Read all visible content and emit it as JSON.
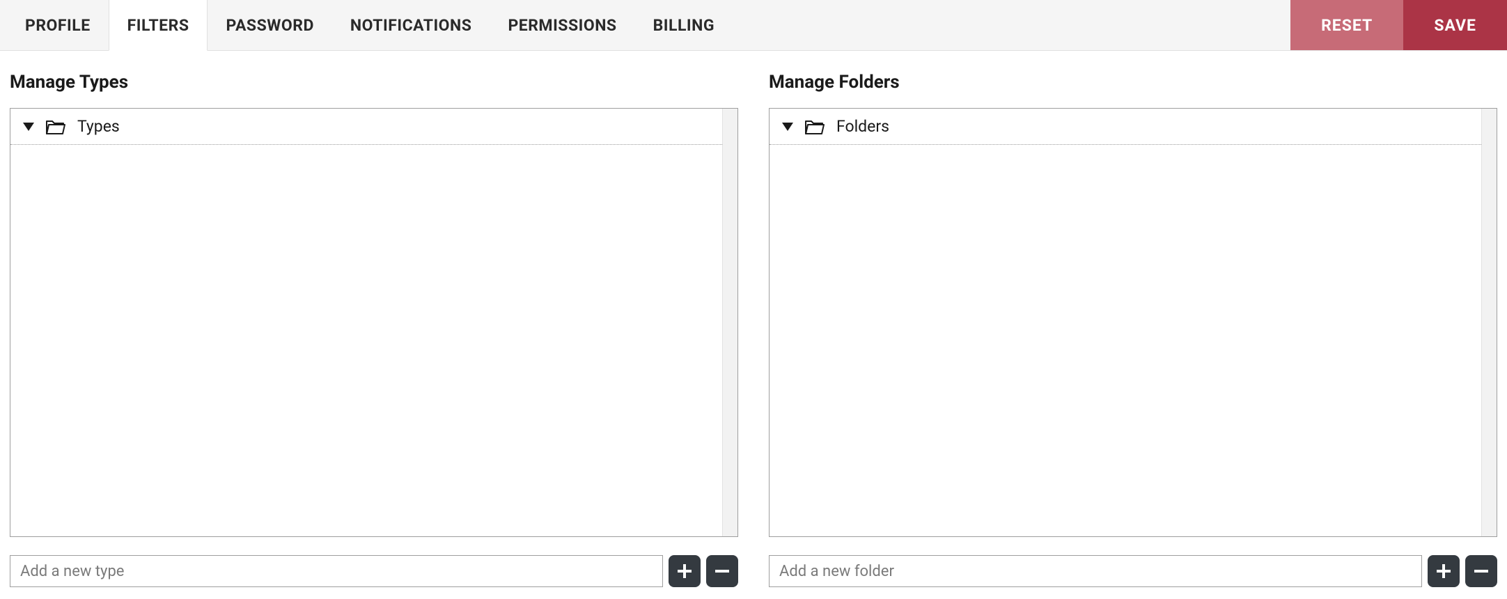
{
  "tabs": {
    "items": [
      {
        "label": "PROFILE",
        "active": false
      },
      {
        "label": "FILTERS",
        "active": true
      },
      {
        "label": "PASSWORD",
        "active": false
      },
      {
        "label": "NOTIFICATIONS",
        "active": false
      },
      {
        "label": "PERMISSIONS",
        "active": false
      },
      {
        "label": "BILLING",
        "active": false
      }
    ],
    "reset_label": "RESET",
    "save_label": "SAVE"
  },
  "types_panel": {
    "title": "Manage Types",
    "root_label": "Types",
    "add_placeholder": "Add a new type"
  },
  "folders_panel": {
    "title": "Manage Folders",
    "root_label": "Folders",
    "add_placeholder": "Add a new folder"
  },
  "icons": {
    "plus": "plus-icon",
    "minus": "minus-icon",
    "folder_open": "folder-open-icon",
    "caret_down": "caret-down-icon"
  }
}
